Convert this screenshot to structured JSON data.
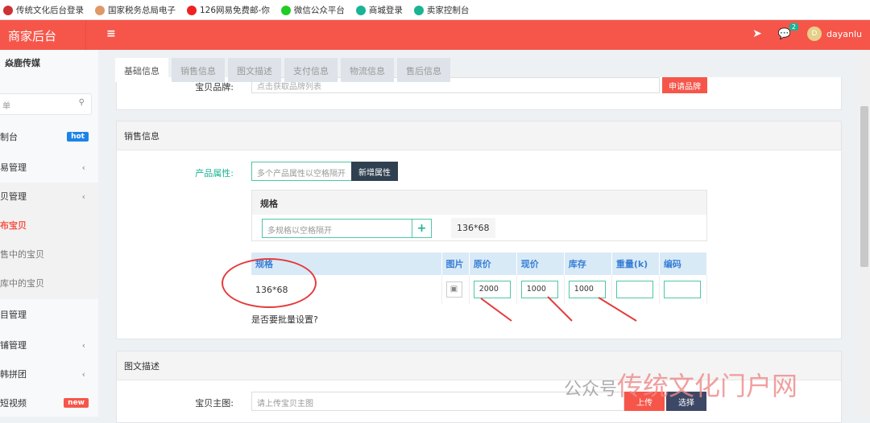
{
  "bookmarks": [
    "传统文化后台登录",
    "国家税务总局电子",
    "126网易免费邮-你",
    "微信公众平台",
    "商城登录",
    "卖家控制台"
  ],
  "header": {
    "title": "商家后台",
    "menu_icon": "hamburger-icon",
    "user": "dayanlu",
    "avatar_letter": "D",
    "message_count": "2"
  },
  "sidebar": {
    "brand": "焱鹿传媒",
    "search_placeholder": "单",
    "items": [
      {
        "label": "制台",
        "tag": "hot",
        "tag_color": "#1c84e6"
      },
      {
        "label": "易管理",
        "chevron": true
      },
      {
        "label": "贝管理",
        "chevron": true
      },
      {
        "label": "布宝贝",
        "active": true
      },
      {
        "label": "售中的宝贝"
      },
      {
        "label": "库中的宝贝"
      },
      {
        "label": "目管理"
      },
      {
        "label": "铺管理",
        "chevron": true
      },
      {
        "label": "韩拼团",
        "chevron": true
      },
      {
        "label": "短视频",
        "tag": "new",
        "tag_color": "#f6564a"
      }
    ]
  },
  "tabs": [
    "基础信息",
    "销售信息",
    "图文描述",
    "支付信息",
    "物流信息",
    "售后信息"
  ],
  "basic": {
    "brand_label": "宝贝品牌:",
    "brand_placeholder": "点击获取品牌列表",
    "apply_button": "申请品牌"
  },
  "sales": {
    "title": "销售信息",
    "attr_label": "产品属性:",
    "attr_placeholder": "多个产品属性以空格隔开",
    "add_attr_button": "新增属性",
    "spec_title": "规格",
    "spec_placeholder": "多规格以空格隔开",
    "spec_add": "+",
    "spec_tag": "136*68",
    "columns": [
      "规格",
      "图片",
      "原价",
      "现价",
      "库存",
      "重量(k)",
      "编码"
    ],
    "row": {
      "spec": "136*68",
      "original_price": "2000",
      "price": "1000",
      "stock": "1000",
      "weight": "",
      "code": ""
    },
    "batch_question": "是否要批量设置?"
  },
  "desc": {
    "title": "图文描述",
    "main_image_label": "宝贝主图:",
    "main_image_placeholder": "请上传宝贝主图",
    "upload_button": "上传",
    "select_button": "选择"
  },
  "watermark": {
    "small": "公众号",
    "big": "传统文化门户网"
  },
  "colors": {
    "accent": "#f6564a",
    "teal": "#1ab394",
    "dark": "#2f4050"
  }
}
